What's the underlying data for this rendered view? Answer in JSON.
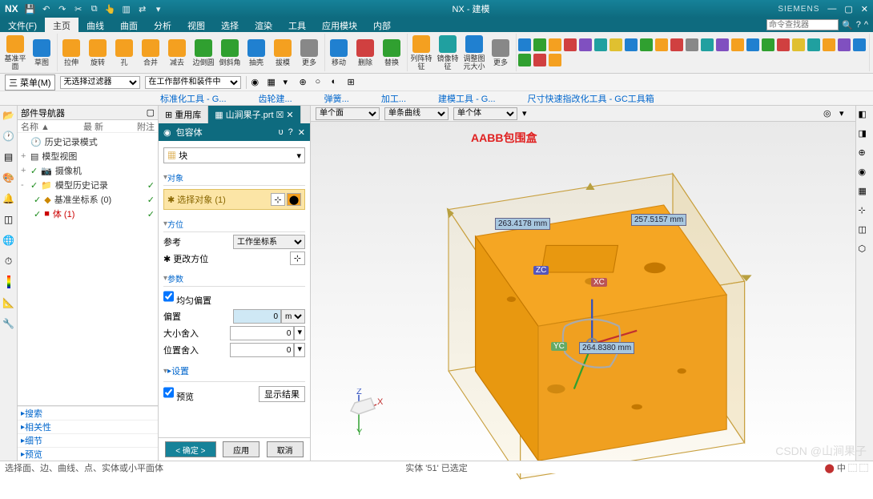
{
  "title": {
    "app": "NX",
    "doc": "NX - 建模",
    "brand": "SIEMENS"
  },
  "ribbonTabs": [
    "文件(F)",
    "主页",
    "曲线",
    "曲面",
    "分析",
    "视图",
    "选择",
    "渲染",
    "工具",
    "应用模块",
    "内部"
  ],
  "ribbonActive": 1,
  "searchPlaceholder": "命令查找器",
  "ribbon": {
    "b1": "基准平面",
    "b2": "草图",
    "b3": "拉伸",
    "b4": "旋转",
    "b5": "孔",
    "b6": "合并",
    "b7": "减去",
    "b8": "边倒圆",
    "b9": "倒斜角",
    "b10": "抽壳",
    "b11": "拔模",
    "b12": "更多",
    "b13": "移动",
    "b14": "删除",
    "b15": "替换",
    "b16": "列阵特征",
    "b17": "镜像特征",
    "b18": "调整图元大小",
    "b19": "更多"
  },
  "toolbar2": {
    "menu": "三 菜单(M)",
    "f1": "无选择过滤器",
    "f2": "在工作部件和装件中"
  },
  "groupLabels": [
    "标准化工具 - G...",
    "齿轮建...",
    "弹簧...",
    "加工...",
    "建模工具 - G...",
    "尺寸快速指改化工具 - GC工具箱"
  ],
  "nav": {
    "title": "部件导航器",
    "cols": [
      "名称 ▲",
      "最 新",
      "附注"
    ],
    "n1": "历史记录模式",
    "n2": "模型视图",
    "n3": "摄像机",
    "n4": "模型历史记录",
    "n5": "基准坐标系 (0)",
    "n6": "体 (1)",
    "sec": [
      "搜索",
      "相关性",
      "细节",
      "预览"
    ]
  },
  "dialog": {
    "tab1": "重用库",
    "tab2": "山涧果子.prt",
    "title": "包容体",
    "typeLabel": "块",
    "sec1": "对象",
    "sel": "选择对象 (1)",
    "sec2": "方位",
    "ref": "参考",
    "refval": "工作坐标系",
    "orient": "更改方位",
    "sec3": "参数",
    "uniform": "均匀偏置",
    "offset": "偏置",
    "offsetval": "0",
    "unit": "mm",
    "sizeround": "大小舍入",
    "sizeval": "0",
    "posround": "位置舍入",
    "posval": "0",
    "sec4": "设置",
    "preview": "预览",
    "showres": "显示结果",
    "ok": "< 确定 >",
    "apply": "应用",
    "cancel": "取消"
  },
  "viewport": {
    "sel1": "单个面",
    "sel2": "单条曲线",
    "sel3": "单个体",
    "annot": "AABB包围盒",
    "dim1": "263.4178 mm",
    "dim2": "257.5157 mm",
    "dim3": "264.8380 mm",
    "zc": "ZC",
    "xc": "XC",
    "yc": "YC"
  },
  "status": {
    "left": "选择面、边、曲线、点、实体或小平面体",
    "mid": "实体 '51' 已选定"
  },
  "watermark": "CSDN @山涧果子"
}
